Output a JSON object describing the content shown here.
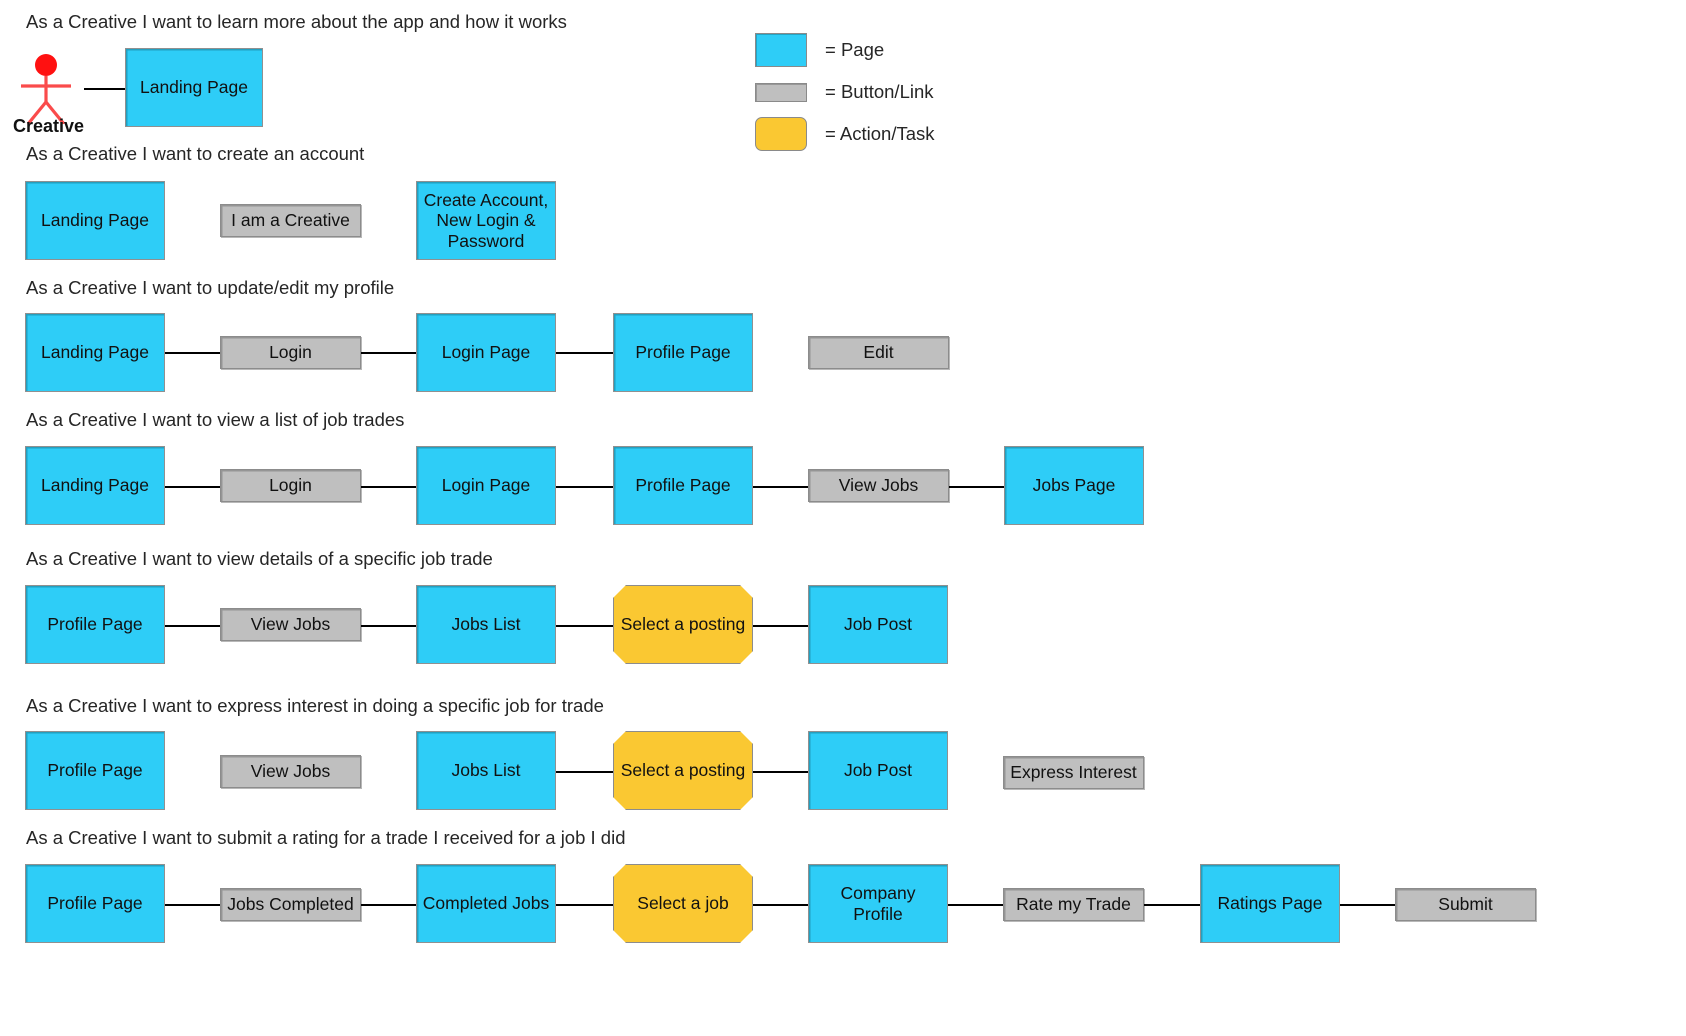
{
  "legend": {
    "items": [
      {
        "shape": "page-swatch",
        "label": "= Page",
        "color": "#2ecdf7"
      },
      {
        "shape": "button-swatch",
        "label": "= Button/Link",
        "color": "#bfbfbf"
      },
      {
        "shape": "task-swatch",
        "label": "= Action/Task",
        "color": "#fac832"
      }
    ]
  },
  "actor": {
    "name": "Creative",
    "icon": "stick-figure-actor-icon",
    "color": "#fa3c3c",
    "head_color": "#ff1a1a"
  },
  "stories": [
    {
      "title": "As a Creative I want to learn more about the app and how it works",
      "nodes": [
        {
          "label": "Landing Page",
          "type": "page"
        }
      ]
    },
    {
      "title": "As a Creative I want to create an account",
      "nodes": [
        {
          "label": "Landing Page",
          "type": "page"
        },
        {
          "label": "I am a Creative",
          "type": "button"
        },
        {
          "label": "Create Account, New Login & Password",
          "type": "page"
        }
      ]
    },
    {
      "title": "As a Creative I want to update/edit my profile",
      "nodes": [
        {
          "label": "Landing Page",
          "type": "page"
        },
        {
          "label": "Login",
          "type": "button"
        },
        {
          "label": "Login Page",
          "type": "page"
        },
        {
          "label": "Profile Page",
          "type": "page"
        },
        {
          "label": "Edit",
          "type": "button"
        }
      ]
    },
    {
      "title": "As a Creative I want to view a list of job trades",
      "nodes": [
        {
          "label": "Landing Page",
          "type": "page"
        },
        {
          "label": "Login",
          "type": "button"
        },
        {
          "label": "Login Page",
          "type": "page"
        },
        {
          "label": "Profile Page",
          "type": "page"
        },
        {
          "label": "View Jobs",
          "type": "button"
        },
        {
          "label": "Jobs Page",
          "type": "page"
        }
      ]
    },
    {
      "title": "As a Creative I want to view details of a specific job trade",
      "nodes": [
        {
          "label": "Profile Page",
          "type": "page"
        },
        {
          "label": "View Jobs",
          "type": "button"
        },
        {
          "label": "Jobs List",
          "type": "page"
        },
        {
          "label": "Select a posting",
          "type": "task"
        },
        {
          "label": "Job Post",
          "type": "page"
        }
      ]
    },
    {
      "title": "As a Creative I want to express interest in doing a specific job for trade",
      "nodes": [
        {
          "label": "Profile Page",
          "type": "page"
        },
        {
          "label": "View Jobs",
          "type": "button"
        },
        {
          "label": "Jobs List",
          "type": "page"
        },
        {
          "label": "Select a posting",
          "type": "task"
        },
        {
          "label": "Job Post",
          "type": "page"
        },
        {
          "label": "Express Interest",
          "type": "button"
        }
      ]
    },
    {
      "title": "As a Creative I want to submit a rating for a trade I received for a job I did",
      "nodes": [
        {
          "label": "Profile Page",
          "type": "page"
        },
        {
          "label": "Jobs Completed",
          "type": "button"
        },
        {
          "label": "Completed Jobs",
          "type": "page"
        },
        {
          "label": "Select a job",
          "type": "task"
        },
        {
          "label": "Company Profile",
          "type": "page"
        },
        {
          "label": "Rate my Trade",
          "type": "button"
        },
        {
          "label": "Ratings Page",
          "type": "page"
        },
        {
          "label": "Submit",
          "type": "button"
        }
      ]
    }
  ]
}
